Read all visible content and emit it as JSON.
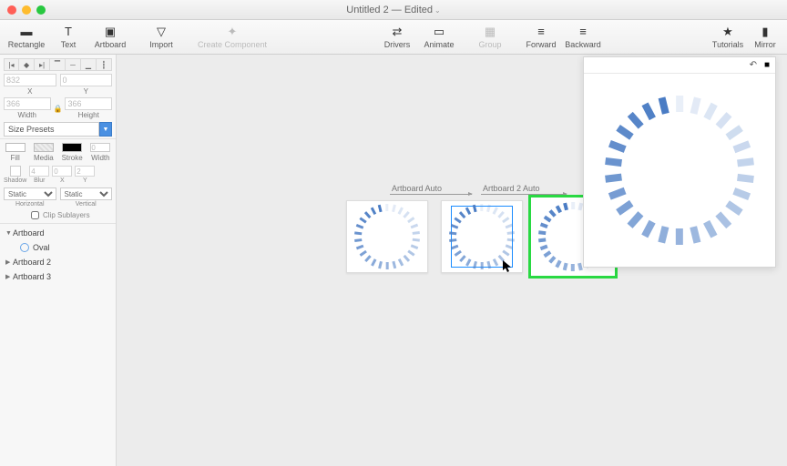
{
  "window": {
    "title": "Untitled 2 — Edited"
  },
  "toolbar": {
    "rectangle": "Rectangle",
    "text": "Text",
    "artboard": "Artboard",
    "import": "Import",
    "create_component": "Create Component",
    "drivers": "Drivers",
    "animate": "Animate",
    "group": "Group",
    "forward": "Forward",
    "backward": "Backward",
    "tutorials": "Tutorials",
    "mirror": "Mirror"
  },
  "inspector": {
    "x": {
      "value": "832",
      "label": "X"
    },
    "y": {
      "value": "0",
      "label": "Y"
    },
    "w": {
      "value": "366",
      "label": "Width"
    },
    "h": {
      "value": "366",
      "label": "Height"
    },
    "size_presets": "Size Presets",
    "fill": "Fill",
    "media": "Media",
    "stroke": "Stroke",
    "width_lbl": "Width",
    "shadow": "Shadow",
    "blur": "Blur",
    "xlbl": "X",
    "ylbl": "Y",
    "blur_v": "4",
    "shx": "0",
    "shy": "2",
    "strokew": "0",
    "static": "Static",
    "horizontal": "Horizontal",
    "vertical": "Vertical",
    "clip": "Clip Sublayers"
  },
  "layers": {
    "items": [
      {
        "name": "Artboard",
        "expanded": true
      },
      {
        "name": "Oval",
        "child": true
      },
      {
        "name": "Artboard 2",
        "expanded": false
      },
      {
        "name": "Artboard 3",
        "expanded": false
      }
    ]
  },
  "canvas": {
    "transition1": "Artboard Auto",
    "transition2": "Artboard 2 Auto"
  },
  "chart_data": {
    "type": "other",
    "title": "Circular loading spinner",
    "ticks": 26,
    "opacity_range": [
      0.1,
      1.0
    ],
    "color": "#4a7cc4"
  }
}
